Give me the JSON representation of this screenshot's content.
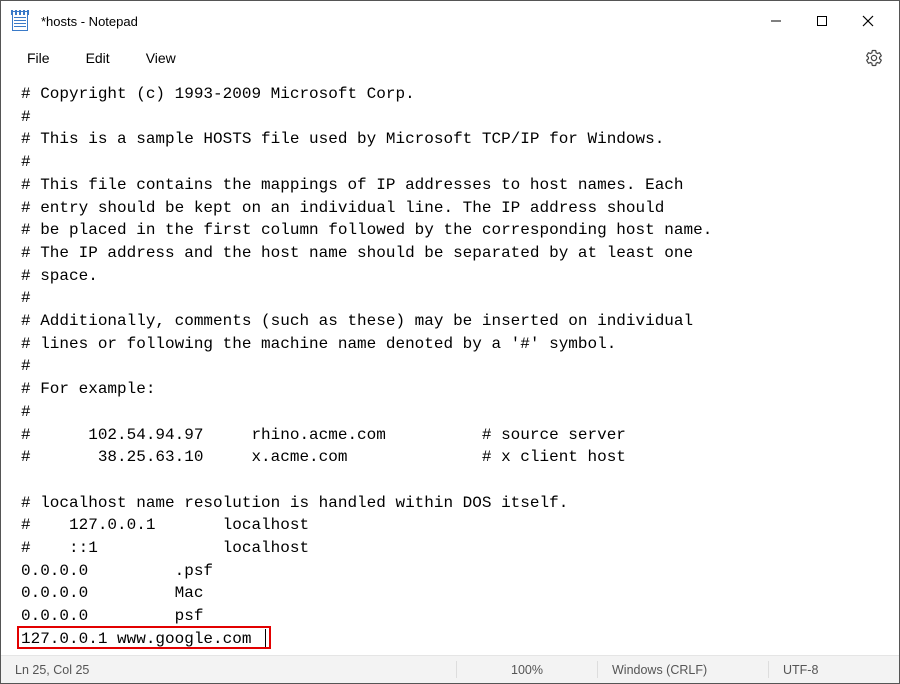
{
  "titlebar": {
    "title": "*hosts - Notepad"
  },
  "menu": {
    "file": "File",
    "edit": "Edit",
    "view": "View"
  },
  "editor": {
    "content": "# Copyright (c) 1993-2009 Microsoft Corp.\n#\n# This is a sample HOSTS file used by Microsoft TCP/IP for Windows.\n#\n# This file contains the mappings of IP addresses to host names. Each\n# entry should be kept on an individual line. The IP address should\n# be placed in the first column followed by the corresponding host name.\n# The IP address and the host name should be separated by at least one\n# space.\n#\n# Additionally, comments (such as these) may be inserted on individual\n# lines or following the machine name denoted by a '#' symbol.\n#\n# For example:\n#\n#      102.54.94.97     rhino.acme.com          # source server\n#       38.25.63.10     x.acme.com              # x client host\n\n# localhost name resolution is handled within DOS itself.\n#    127.0.0.1       localhost\n#    ::1             localhost\n0.0.0.0         .psf\n0.0.0.0         Mac\n0.0.0.0         psf\n127.0.0.1 www.google.com"
  },
  "status": {
    "position": "Ln 25, Col 25",
    "zoom": "100%",
    "lineending": "Windows (CRLF)",
    "encoding": "UTF-8"
  }
}
